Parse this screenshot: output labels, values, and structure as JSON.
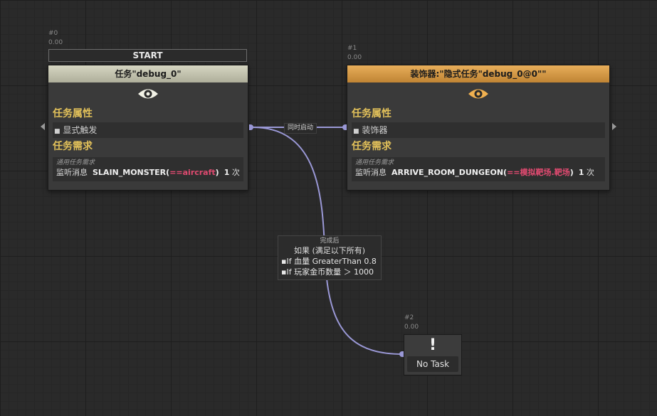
{
  "nodes": {
    "n0": {
      "index": "#0",
      "time": "0.00",
      "start_label": "START",
      "title": "任务\"debug_0\"",
      "section_props": "任务属性",
      "prop_item": "显式触发",
      "section_req": "任务需求",
      "req_sub": "通用任务需求",
      "req_prefix": "监听消息",
      "req_cmd": "SLAIN_MONSTER(",
      "req_hl": "==aircraft",
      "req_close": ")",
      "req_count": "1",
      "req_unit": "次"
    },
    "n1": {
      "index": "#1",
      "time": "0.00",
      "title": "装饰器:\"隐式任务\"debug_0@0\"\"",
      "section_props": "任务属性",
      "prop_item": "装饰器",
      "section_req": "任务需求",
      "req_sub": "通用任务需求",
      "req_prefix": "监听消息",
      "req_cmd": "ARRIVE_ROOM_DUNGEON(",
      "req_hl": "==模拟靶场.靶场",
      "req_close": ")",
      "req_count": "1",
      "req_unit": "次"
    },
    "n2": {
      "index": "#2",
      "time": "0.00",
      "icon": "!",
      "label": "No Task"
    }
  },
  "edges": {
    "link_label": "同时启动",
    "cond_head": "完成后",
    "cond_if": "如果 (满足以下所有)",
    "cond_1": "▪If 血量 GreaterThan 0.8",
    "cond_2": "▪If 玩家金币数量 ＞ 1000"
  },
  "colors": {
    "wire": "#9a98d6",
    "accent_title": "#e2c15a",
    "highlight": "#e04a70",
    "header_grey": "#c2c2ae",
    "header_gold": "#d49a45",
    "eye_white": "#f2f2e6",
    "eye_gold": "#f0b050"
  }
}
